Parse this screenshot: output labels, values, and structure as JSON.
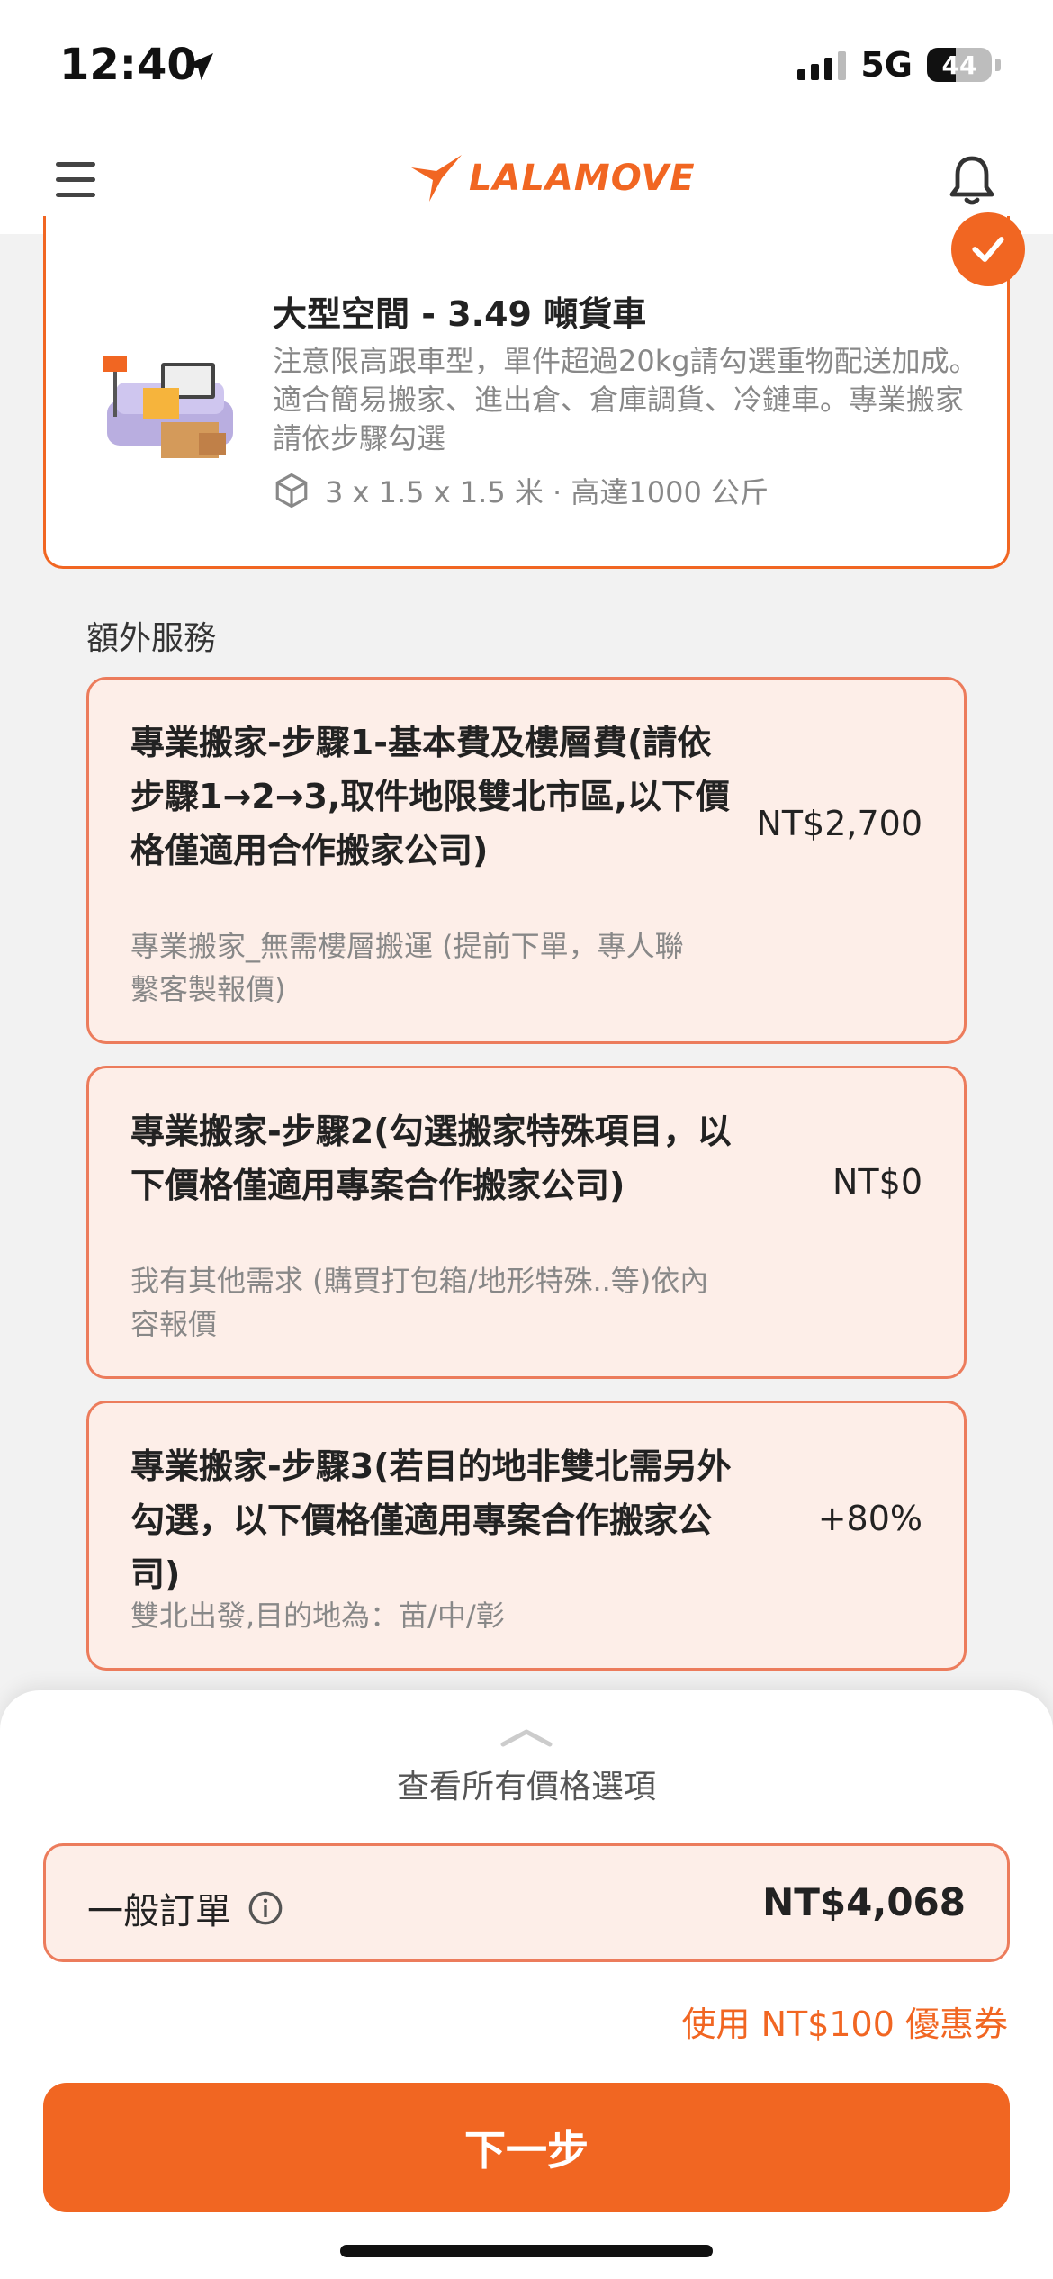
{
  "status_bar": {
    "time": "12:40",
    "network": "5G",
    "battery": "44",
    "battery_level": 0.44
  },
  "header": {
    "logo_text": "LALAMOVE"
  },
  "vehicle": {
    "title": "大型空間 - 3.49 噸貨車",
    "description": "注意限高跟車型，單件超過20kg請勾選重物配送加成。適合簡易搬家、進出倉、倉庫調貨、冷鏈車。專業搬家請依步驟勾選",
    "spec": "3 x 1.5 x 1.5 米 · 高達1000 公斤"
  },
  "extra_services": {
    "section_title": "額外服務",
    "items": [
      {
        "title": "專業搬家-步驟1-基本費及樓層費(請依步驟1→2→3,取件地限雙北市區,以下價格僅適用合作搬家公司)",
        "subtitle": "專業搬家_無需樓層搬運 (提前下單，專人聯繫客製報價)",
        "price": "NT$2,700"
      },
      {
        "title": "專業搬家-步驟2(勾選搬家特殊項目，以下價格僅適用專案合作搬家公司)",
        "subtitle": "我有其他需求 (購買打包箱/地形特殊..等)依內容報價",
        "price": "NT$0"
      },
      {
        "title": "專業搬家-步驟3(若目的地非雙北需另外勾選，以下價格僅適用專案合作搬家公司)",
        "subtitle": "雙北出發,目的地為：苗/中/彰",
        "price": "+80%"
      }
    ]
  },
  "bottom_sheet": {
    "view_all_label": "查看所有價格選項",
    "order_type": "一般訂單",
    "total": "NT$4,068",
    "coupon": "使用 NT$100 優惠券",
    "next_label": "下一步"
  },
  "colors": {
    "accent": "#f16622",
    "card_bg": "#fdeee8",
    "card_border": "#ec7c5c"
  }
}
